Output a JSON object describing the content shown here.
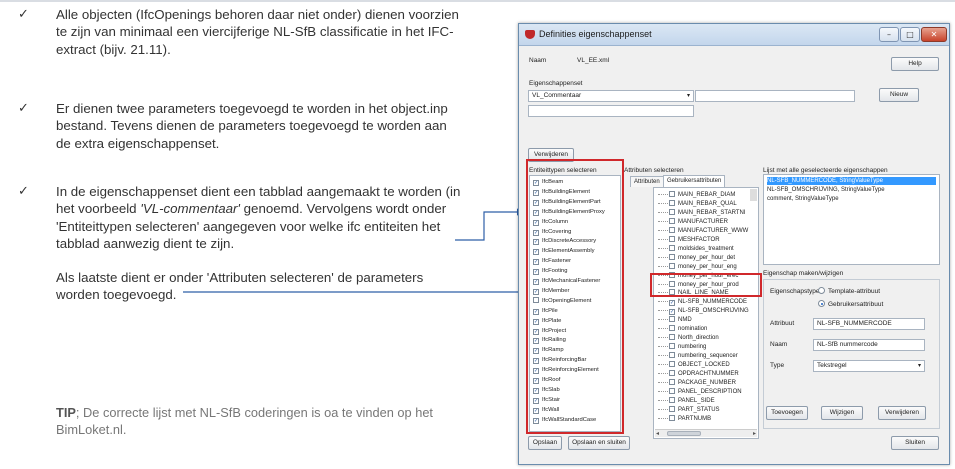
{
  "slide": {
    "bullets": [
      {
        "lines": [
          "Alle objecten (IfcOpenings behoren daar niet onder) dienen voorzien",
          "te zijn van minimaal een viercijferige NL-SfB classificatie in het IFC-",
          "extract (bijv. 21.11)."
        ]
      },
      {
        "lines": [
          "Er dienen twee parameters toegevoegd te worden in het object.inp",
          "bestand. Tevens dienen de parameters toegevoegd te worden aan",
          "de extra eigenschappenset."
        ]
      },
      {
        "lines_prefix": "In de eigenschappenset dient een tabblad aangemaakt te worden (in",
        "line2_a": "het voorbeeld ",
        "line2_em": "'VL-commentaar'",
        "line2_b": " genoemd. Vervolgens wordt onder",
        "line3": "'Entiteittypen selecteren' aangegeven voor welke ifc entiteiten het",
        "line4": "tabblad aanwezig dient te zijn."
      }
    ],
    "sub_lines": [
      "Als laatste dient er onder 'Attributen selecteren' de parameters",
      "worden toegevoegd."
    ],
    "tip_label": "TIP",
    "tip_text": "; De correcte lijst met NL-SfB coderingen is oa te vinden op het",
    "tip_text2": "BimLoket.nl."
  },
  "dialog": {
    "title": "Definities eigenschappenset",
    "win_min": "–",
    "win_max": "□",
    "win_close": "✕",
    "naam_label": "Naam",
    "naam_value": "VL_EE.xml",
    "help_button": "Help",
    "set_label": "Eigenschappenset",
    "set_value": "VL_Commentaar",
    "nieuw_button": "Nieuw",
    "verwijderen_button": "Verwijderen",
    "entities_label": "Entiteittypen selecteren",
    "attributes_label": "Attributen selecteren",
    "selected_label": "Lijst met alle geselecteerde eigenschappen",
    "tab_attributen": "Attributen",
    "tab_gebruikers": "Gebruikersattributen",
    "entities": [
      {
        "name": "IfcBeam",
        "checked": true
      },
      {
        "name": "IfcBuildingElement",
        "checked": true
      },
      {
        "name": "IfcBuildingElementPart",
        "checked": true
      },
      {
        "name": "IfcBuildingElementProxy",
        "checked": true
      },
      {
        "name": "IfcColumn",
        "checked": true
      },
      {
        "name": "IfcCovering",
        "checked": true
      },
      {
        "name": "IfcDiscreteAccessory",
        "checked": true
      },
      {
        "name": "IfcElementAssembly",
        "checked": true
      },
      {
        "name": "IfcFastener",
        "checked": true
      },
      {
        "name": "IfcFooting",
        "checked": true
      },
      {
        "name": "IfcMechanicalFastener",
        "checked": true
      },
      {
        "name": "IfcMember",
        "checked": true
      },
      {
        "name": "IfcOpeningElement",
        "checked": false
      },
      {
        "name": "IfcPile",
        "checked": true
      },
      {
        "name": "IfcPlate",
        "checked": true
      },
      {
        "name": "IfcProject",
        "checked": true
      },
      {
        "name": "IfcRailing",
        "checked": true
      },
      {
        "name": "IfcRamp",
        "checked": true
      },
      {
        "name": "IfcReinforcingBar",
        "checked": true
      },
      {
        "name": "IfcReinforcingElement",
        "checked": true
      },
      {
        "name": "IfcRoof",
        "checked": true
      },
      {
        "name": "IfcSlab",
        "checked": true
      },
      {
        "name": "IfcStair",
        "checked": true
      },
      {
        "name": "IfcWall",
        "checked": true
      },
      {
        "name": "IfcWallStandardCase",
        "checked": true
      }
    ],
    "attributes": [
      {
        "name": "MAIN_REBAR_DIAM",
        "checked": false
      },
      {
        "name": "MAIN_REBAR_QUAL",
        "checked": false
      },
      {
        "name": "MAIN_REBAR_STARTNI",
        "checked": false
      },
      {
        "name": "MANUFACTURER",
        "checked": false
      },
      {
        "name": "MANUFACTURER_WWW",
        "checked": false
      },
      {
        "name": "MESHFACTOR",
        "checked": false
      },
      {
        "name": "moldsides_treatment",
        "checked": false
      },
      {
        "name": "money_per_hour_det",
        "checked": false
      },
      {
        "name": "money_per_hour_eng",
        "checked": false
      },
      {
        "name": "money_per_hour_erec",
        "checked": false
      },
      {
        "name": "money_per_hour_prod",
        "checked": false
      },
      {
        "name": "NAIL_LINE_NAME",
        "checked": false
      },
      {
        "name": "NL-SFB_NUMMERCODE",
        "checked": true
      },
      {
        "name": "NL-SFB_OMSCHRIJVING",
        "checked": true
      },
      {
        "name": "NMD",
        "checked": false
      },
      {
        "name": "nomination",
        "checked": false
      },
      {
        "name": "North_direction",
        "checked": false
      },
      {
        "name": "numbering",
        "checked": false
      },
      {
        "name": "numbering_sequencer",
        "checked": false
      },
      {
        "name": "OBJECT_LOCKED",
        "checked": false
      },
      {
        "name": "OPDRACHTNUMMER",
        "checked": false
      },
      {
        "name": "PACKAGE_NUMBER",
        "checked": false
      },
      {
        "name": "PANEL_DESCRIPTION",
        "checked": false
      },
      {
        "name": "PANEL_SIDE",
        "checked": false
      },
      {
        "name": "PART_STATUS",
        "checked": false
      },
      {
        "name": "PARTNUMB",
        "checked": false
      }
    ],
    "selected": [
      {
        "text": "NL-SFB_NUMMERCODE, StringValueType",
        "highlight": true
      },
      {
        "text": "NL-SFB_OMSCHRIJVING, StringValueType",
        "highlight": false
      },
      {
        "text": "comment, StringValueType",
        "highlight": false
      }
    ],
    "edit_label": "Eigenschap maken/wijzigen",
    "type_label": "Eigenschapstype",
    "radio_template": "Template-attribuut",
    "radio_user": "Gebruikersattribuut",
    "attribuut_label": "Attribuut",
    "attribuut_value": "NL-SFB_NUMMERCODE",
    "naam2_label": "Naam",
    "naam2_value": "NL-SfB nummercode",
    "type2_label": "Type",
    "type2_value": "Tekstregel",
    "toevoegen_button": "Toevoegen",
    "wijzigen_button": "Wijzigen",
    "verwijderen2_button": "Verwijderen",
    "opslaan_button": "Opslaan",
    "opslaan_sluiten_button": "Opslaan en sluiten",
    "sluiten_button": "Sluiten",
    "dropdown_icon": "▾",
    "scroll_left": "◂",
    "scroll_right": "▸"
  }
}
